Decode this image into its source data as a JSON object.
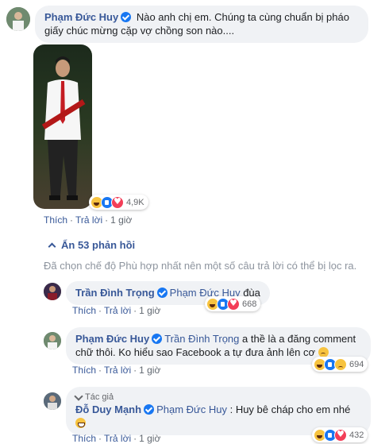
{
  "comments": {
    "main": {
      "author": "Phạm Đức Huy",
      "text": "Nào anh chị em. Chúng ta cùng chuẩn bị pháo giấy chúc mừng cặp vợ chồng son nào....",
      "reaction_count": "4,9K",
      "actions": {
        "like": "Thích",
        "reply": "Trả lời",
        "time": "1 giờ"
      }
    },
    "replies_toggle": "Ẩn 53 phản hồi",
    "filter_note": "Đã chọn chế độ Phù hợp nhất nên một số câu trả lời có thể bị lọc ra.",
    "reply1": {
      "author": "Trần Đình Trọng",
      "mention": "Phạm Đức Huy",
      "text": "đùa",
      "reaction_count": "668",
      "actions": {
        "like": "Thích",
        "reply": "Trả lời",
        "time": "1 giờ"
      }
    },
    "reply2": {
      "author": "Phạm Đức Huy",
      "mention": "Trần Đình Trọng",
      "text": "a thề là a đăng comment chữ thôi. Ko hiểu sao Facebook a tự đưa ảnh lên cơ",
      "reaction_count": "694",
      "actions": {
        "like": "Thích",
        "reply": "Trả lời",
        "time": "1 giờ"
      }
    },
    "reply3": {
      "badge": "Tác giả",
      "author": "Đỗ Duy Mạnh",
      "mention": "Phạm Đức Huy",
      "text": ": Huy bê cháp cho em nhé",
      "reaction_count": "432",
      "actions": {
        "like": "Thích",
        "reply": "Trả lời",
        "time": "1 giờ"
      }
    }
  },
  "colors": {
    "link": "#385898",
    "bubble": "#f0f2f5",
    "meta": "#606770",
    "verified": "#1877f2"
  }
}
